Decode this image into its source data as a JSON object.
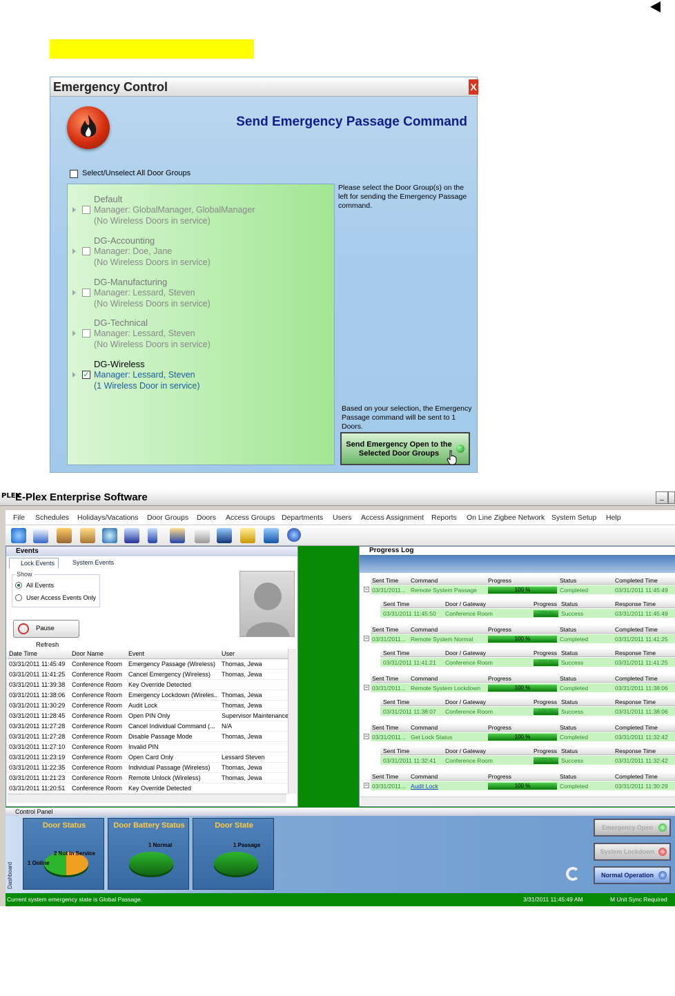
{
  "dialog": {
    "title": "Emergency Control",
    "close": "X",
    "heading": "Send Emergency Passage Command",
    "select_all": "Select/Unselect All Door Groups",
    "groups": [
      {
        "name": "Default",
        "manager": "Manager: GlobalManager, GlobalManager",
        "service": "(No Wireless Doors in service)",
        "checked": false
      },
      {
        "name": "DG-Accounting",
        "manager": "Manager: Doe, Jane",
        "service": "(No Wireless Doors in service)",
        "checked": false
      },
      {
        "name": "DG-Manufacturing",
        "manager": "Manager: Lessard, Steven",
        "service": "(No Wireless Doors in service)",
        "checked": false
      },
      {
        "name": "DG-Technical",
        "manager": "Manager: Lessard, Steven",
        "service": "(No Wireless Doors in service)",
        "checked": false
      },
      {
        "name": "DG-Wireless",
        "manager": "Manager: Lessard, Steven",
        "service": "(1 Wireless Door in service)",
        "checked": true
      }
    ],
    "help_text": "Please select the Door Group(s) on the left for sending the Emergency Passage command.",
    "based_text": "Based on your selection, the Emergency Passage command will be sent to 1 Doors.",
    "send_button": "Send Emergency Open to the Selected Door Groups"
  },
  "app": {
    "logo": "PLEX",
    "title": "E-Plex Enterprise Software",
    "menu": [
      "File",
      "Schedules",
      "Holidays/Vacations",
      "Door Groups",
      "Doors",
      "Access Groups",
      "Departments",
      "Users",
      "Access Assignment",
      "Reports",
      "On Line Zigbee Network",
      "System Setup",
      "Help"
    ],
    "events": {
      "title": "Events",
      "tabs": [
        "Lock Events",
        "System Events"
      ],
      "show_label": "Show",
      "options": [
        "All Events",
        "User Access Events Only"
      ],
      "pause_button": "Pause Refresh",
      "columns": [
        "Date Time",
        "Door Name",
        "Event",
        "User"
      ],
      "rows": [
        [
          "03/31/2011 11:45:49",
          "Conference Room",
          "Emergency Passage (Wireless)",
          "Thomas, Jewa"
        ],
        [
          "03/31/2011 11:41:25",
          "Conference Room",
          "Cancel Emergency (Wireless)",
          "Thomas, Jewa"
        ],
        [
          "03/31/2011 11:39:38",
          "Conference Room",
          "Key Override Detected",
          ""
        ],
        [
          "03/31/2011 11:38:06",
          "Conference Room",
          "Emergency Lockdown (Wireles...",
          "Thomas, Jewa"
        ],
        [
          "03/31/2011 11:30:29",
          "Conference Room",
          "Audit Lock",
          "Thomas, Jewa"
        ],
        [
          "03/31/2011 11:28:45",
          "Conference Room",
          "Open PIN Only",
          "Supervisor Maintenance"
        ],
        [
          "03/31/2011 11:27:28",
          "Conference Room",
          "Cancel Individual Command (...",
          "N/A"
        ],
        [
          "03/31/2011 11:27:28",
          "Conference Room",
          "Disable Passage Mode",
          "Thomas, Jewa"
        ],
        [
          "03/31/2011 11:27:10",
          "Conference Room",
          "Invalid PIN",
          ""
        ],
        [
          "03/31/2011 11:23:19",
          "Conference Room",
          "Open Card Only",
          "Lessard Steven"
        ],
        [
          "03/31/2011 11:22:35",
          "Conference Room",
          "Individual Passage (Wireless)",
          "Thomas, Jewa"
        ],
        [
          "03/31/2011 11:21:23",
          "Conference Room",
          "Remote Unlock (Wireless)",
          "Thomas, Jewa"
        ],
        [
          "03/31/2011 11:20:51",
          "Conference Room",
          "Key Override Detected",
          ""
        ]
      ]
    },
    "progress_log": {
      "title": "Progress Log",
      "cmd_headers": [
        "Sent Time",
        "Command",
        "Progress",
        "Status",
        "Completed Time"
      ],
      "sub_headers": [
        "Sent Time",
        "Door / Gateway",
        "Progress",
        "Status",
        "Response Time"
      ],
      "entries": [
        {
          "sent": "03/31/2011...",
          "command": "Remote System Passage",
          "progress": "100 %",
          "status": "Completed",
          "completed": "03/31/2011 11:45:49",
          "sub": {
            "sent": "03/31/2011 11:45:50",
            "door": "Conference Room",
            "progress": "100 %",
            "status": "Success",
            "response": "03/31/2011 11:45:49"
          }
        },
        {
          "sent": "03/31/2011...",
          "command": "Remote System Normal",
          "progress": "100 %",
          "status": "Completed",
          "completed": "03/31/2011 11:41:25",
          "sub": {
            "sent": "03/31/2011 11:41:21",
            "door": "Conference Room",
            "progress": "100 %",
            "status": "Success",
            "response": "03/31/2011 11:41:25"
          }
        },
        {
          "sent": "03/31/2011...",
          "command": "Remote System Lockdown",
          "progress": "100 %",
          "status": "Completed",
          "completed": "03/31/2011 11:38:06",
          "sub": {
            "sent": "03/31/2011 11:38:07",
            "door": "Conference Room",
            "progress": "100 %",
            "status": "Success",
            "response": "03/31/2011 11:38:06"
          }
        },
        {
          "sent": "03/31/2011...",
          "command": "Get Lock Status",
          "progress": "100 %",
          "status": "Completed",
          "completed": "03/31/2011 11:32:42",
          "sub": {
            "sent": "03/31/2011 11:32:41",
            "door": "Conference Room",
            "progress": "100 %",
            "status": "Success",
            "response": "03/31/2011 11:32:42"
          }
        },
        {
          "sent": "03/31/2011...",
          "command": "Audit Lock",
          "progress": "100 %",
          "status": "Completed",
          "completed": "03/31/2011 11:30:29",
          "sub": null
        }
      ]
    },
    "control_panel": {
      "title": "Control Panel",
      "dashboard_tab": "Dashboard",
      "tiles": [
        {
          "title": "Door Status",
          "labels": [
            "2 Not In Service",
            "1 Online"
          ]
        },
        {
          "title": "Door Battery Status",
          "labels": [
            "1 Normal"
          ]
        },
        {
          "title": "Door State",
          "labels": [
            "1 Passage"
          ]
        }
      ],
      "buttons": [
        "Emergency Open",
        "System Lockdown",
        "Normal Operation"
      ]
    },
    "status": {
      "message": "Current system emergency state is Global Passage.",
      "time": "3/31/2011 11:45:49 AM",
      "sync": "M Unit Sync Required"
    }
  }
}
